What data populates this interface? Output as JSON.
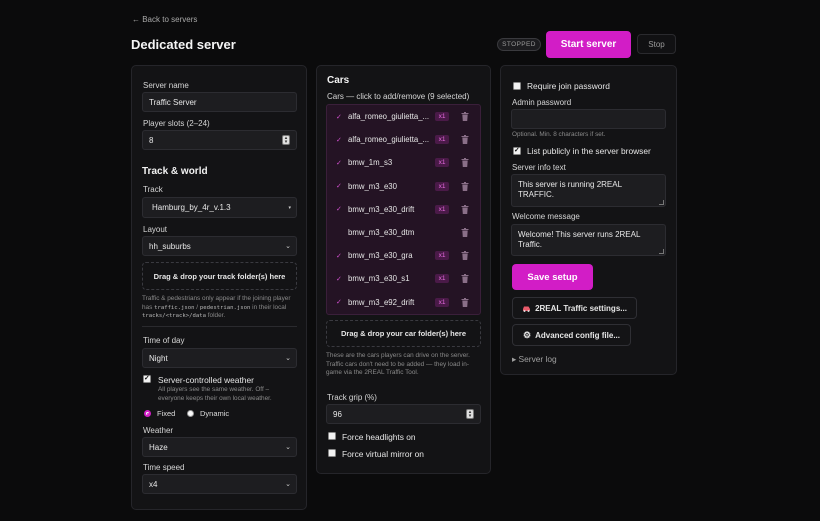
{
  "header": {
    "back_link": "← Back to servers",
    "title": "Dedicated server",
    "status": "STOPPED",
    "start_button": "Start server",
    "stop_button": "Stop"
  },
  "server": {
    "name_label": "Server name",
    "name_value": "Traffic Server",
    "slots_label": "Player slots (2–24)",
    "slots_value": "8"
  },
  "track_world": {
    "heading": "Track & world",
    "track_label": "Track",
    "track_value": "Hamburg_by_4r_v.1.3",
    "layout_label": "Layout",
    "layout_value": "hh_suburbs",
    "dropzone": "Drag & drop your track folder(s) here",
    "hint_1": "Traffic & pedestrians only appear if the joining player has",
    "hint_code_1": "traffic.json",
    "hint_sep": " / ",
    "hint_code_2": "pedestrian.json",
    "hint_2": " in",
    "hint_3": "their local",
    "hint_code_3": "tracks/<track>/data",
    "hint_4": " folder.",
    "time_label": "Time of day",
    "time_value": "Night",
    "weather_control_label": "Server-controlled weather",
    "weather_control_hint": "All players see the same weather. Off – everyone keeps their own local weather.",
    "radio_fixed": "Fixed",
    "radio_dynamic": "Dynamic",
    "weather_label": "Weather",
    "weather_value": "Haze",
    "speed_label": "Time speed",
    "speed_value": "x4"
  },
  "cars": {
    "heading": "Cars",
    "subheading": "Cars — click to add/remove (9 selected)",
    "list": [
      {
        "name": "alfa_romeo_giulietta_...",
        "checked": true,
        "count": "x1"
      },
      {
        "name": "alfa_romeo_giulietta_...",
        "checked": true,
        "count": "x1"
      },
      {
        "name": "bmw_1m_s3",
        "checked": true,
        "count": "x1"
      },
      {
        "name": "bmw_m3_e30",
        "checked": true,
        "count": "x1"
      },
      {
        "name": "bmw_m3_e30_drift",
        "checked": true,
        "count": "x1"
      },
      {
        "name": "bmw_m3_e30_dtm",
        "checked": false,
        "count": ""
      },
      {
        "name": "bmw_m3_e30_gra",
        "checked": true,
        "count": "x1"
      },
      {
        "name": "bmw_m3_e30_s1",
        "checked": true,
        "count": "x1"
      },
      {
        "name": "bmw_m3_e92_drift",
        "checked": true,
        "count": "x1"
      }
    ],
    "dropzone": "Drag & drop your car folder(s) here",
    "hint": "These are the cars players can drive on the server. Traffic cars don't need to be added — they load in-game via the 2REAL Traffic Tool.",
    "grip_label": "Track grip (%)",
    "grip_value": "96",
    "headlights_label": "Force headlights on",
    "mirror_label": "Force virtual mirror on"
  },
  "access": {
    "require_password_label": "Require join password",
    "admin_password_label": "Admin password",
    "admin_password_value": "",
    "admin_password_hint": "Optional. Min. 8 characters if set.",
    "list_public_label": "List publicly in the server browser",
    "info_label": "Server info text",
    "info_value": "This server is running 2REAL TRAFFIC.",
    "welcome_label": "Welcome message",
    "welcome_value": "Welcome! This server runs 2REAL Traffic.",
    "save_button": "Save setup",
    "traffic_settings_button": "2REAL Traffic settings...",
    "advanced_button": "Advanced config file...",
    "server_log": "▸ Server log"
  },
  "colors": {
    "accent": "#d21dc6",
    "background": "#0b0b0c",
    "card": "#131315"
  },
  "icons": {
    "traffic_settings": "car-icon",
    "advanced": "gear-icon",
    "delete": "trash-icon"
  }
}
